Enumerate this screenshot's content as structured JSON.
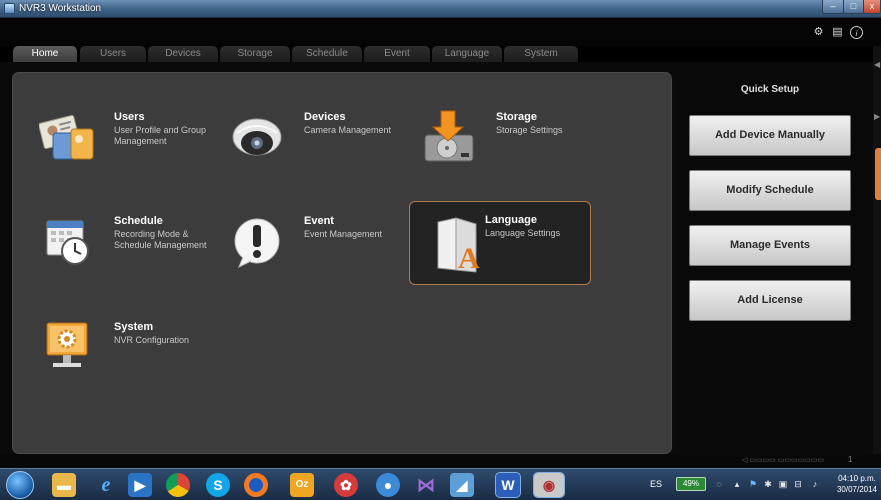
{
  "window": {
    "title": "NVR3 Workstation",
    "min": "–",
    "max": "□",
    "close": "x"
  },
  "header": {
    "icons": [
      "gear-icon",
      "document-icon",
      "info-icon"
    ]
  },
  "tabs": [
    {
      "label": "Home"
    },
    {
      "label": "Users"
    },
    {
      "label": "Devices"
    },
    {
      "label": "Storage"
    },
    {
      "label": "Schedule"
    },
    {
      "label": "Event"
    },
    {
      "label": "Language"
    },
    {
      "label": "System"
    }
  ],
  "tiles": [
    {
      "title": "Users",
      "desc": "User Profile and Group Management",
      "icon": "users-id-card-icon"
    },
    {
      "title": "Devices",
      "desc": "Camera Management",
      "icon": "dome-camera-icon"
    },
    {
      "title": "Storage",
      "desc": "Storage Settings",
      "icon": "hard-drive-icon"
    },
    {
      "title": "Schedule",
      "desc": "Recording Mode & Schedule Management",
      "icon": "calendar-clock-icon"
    },
    {
      "title": "Event",
      "desc": "Event Management",
      "icon": "exclamation-bubble-icon"
    },
    {
      "title": "Language",
      "desc": "Language Settings",
      "icon": "language-book-icon"
    },
    {
      "title": "System",
      "desc": "NVR Configuration",
      "icon": "monitor-gear-icon"
    }
  ],
  "quick_setup": {
    "title": "Quick Setup",
    "buttons": [
      "Add Device Manually",
      "Modify Schedule",
      "Manage Events",
      "Add License"
    ]
  },
  "status": {
    "count": "1"
  },
  "taskbar": {
    "apps": [
      "explorer",
      "internet-explorer",
      "media-player",
      "chrome",
      "skype",
      "firefox",
      "outlook",
      "app-red",
      "app-blue",
      "visual-studio",
      "app-folder",
      "word",
      "nvr-app"
    ],
    "language": "ES",
    "battery": "49%",
    "time": "04:10 p.m.",
    "date": "30/07/2014"
  }
}
